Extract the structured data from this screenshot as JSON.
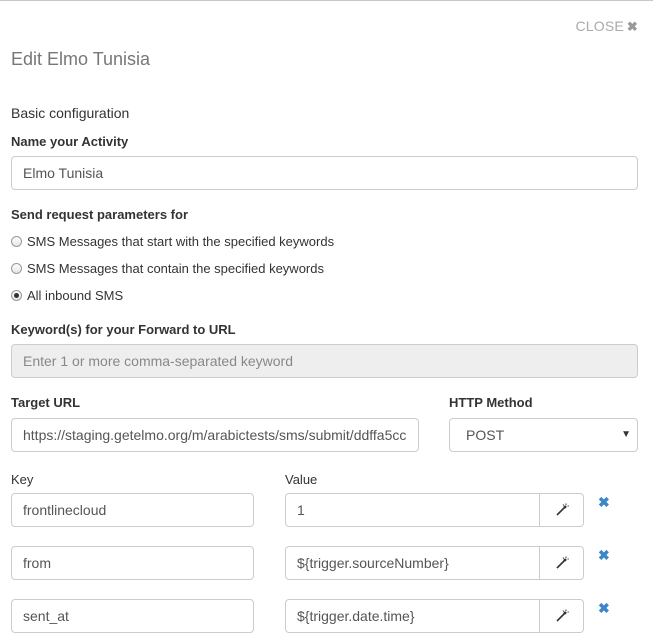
{
  "dialog": {
    "close_label": "CLOSE",
    "close_glyph": "✖",
    "title": "Edit Elmo Tunisia",
    "section_title": "Basic configuration"
  },
  "activity": {
    "label": "Name your Activity",
    "value": "Elmo Tunisia"
  },
  "request_params": {
    "label": "Send request parameters for",
    "options": [
      {
        "label": "SMS Messages that start with the specified keywords",
        "checked": false
      },
      {
        "label": "SMS Messages that contain the specified keywords",
        "checked": false
      },
      {
        "label": "All inbound SMS",
        "checked": true
      }
    ]
  },
  "keywords": {
    "label": "Keyword(s) for your Forward to URL",
    "placeholder": "Enter 1 or more comma-separated keyword"
  },
  "target_url": {
    "label": "Target URL",
    "value": "https://staging.getelmo.org/m/arabictests/sms/submit/ddffa5cc"
  },
  "http_method": {
    "label": "HTTP Method",
    "selected": "POST"
  },
  "params": {
    "key_header": "Key",
    "value_header": "Value",
    "rows": [
      {
        "key": "frontlinecloud",
        "value": "1"
      },
      {
        "key": "from",
        "value": "${trigger.sourceNumber}"
      },
      {
        "key": "sent_at",
        "value": "${trigger.date.time}"
      }
    ]
  },
  "colors": {
    "remove_icon": "#3b87c8",
    "disabled_field": "#eeeeee"
  }
}
